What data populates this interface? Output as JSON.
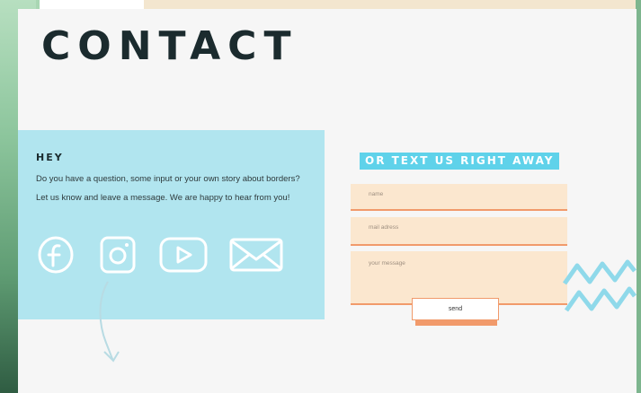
{
  "page": {
    "title": "CONTACT"
  },
  "intro_panel": {
    "heading": "HEY",
    "line1": "Do you have a question, some input or your own story about borders?",
    "line2": "Let us know and leave a message. We are happy to hear from you!",
    "background": "#b1e5ef"
  },
  "social": [
    {
      "icon": "facebook-icon"
    },
    {
      "icon": "instagram-icon"
    },
    {
      "icon": "youtube-icon"
    },
    {
      "icon": "mail-icon"
    }
  ],
  "form": {
    "heading": "OR TEXT US RIGHT AWAY",
    "name_placeholder": "name",
    "email_placeholder": "mail adress",
    "message_placeholder": "your message",
    "submit_label": "send"
  },
  "colors": {
    "accent_blue": "#5fd2ea",
    "field_fill": "#fbe7cf",
    "field_border": "#f19a6b",
    "title": "#1b2b2e"
  }
}
